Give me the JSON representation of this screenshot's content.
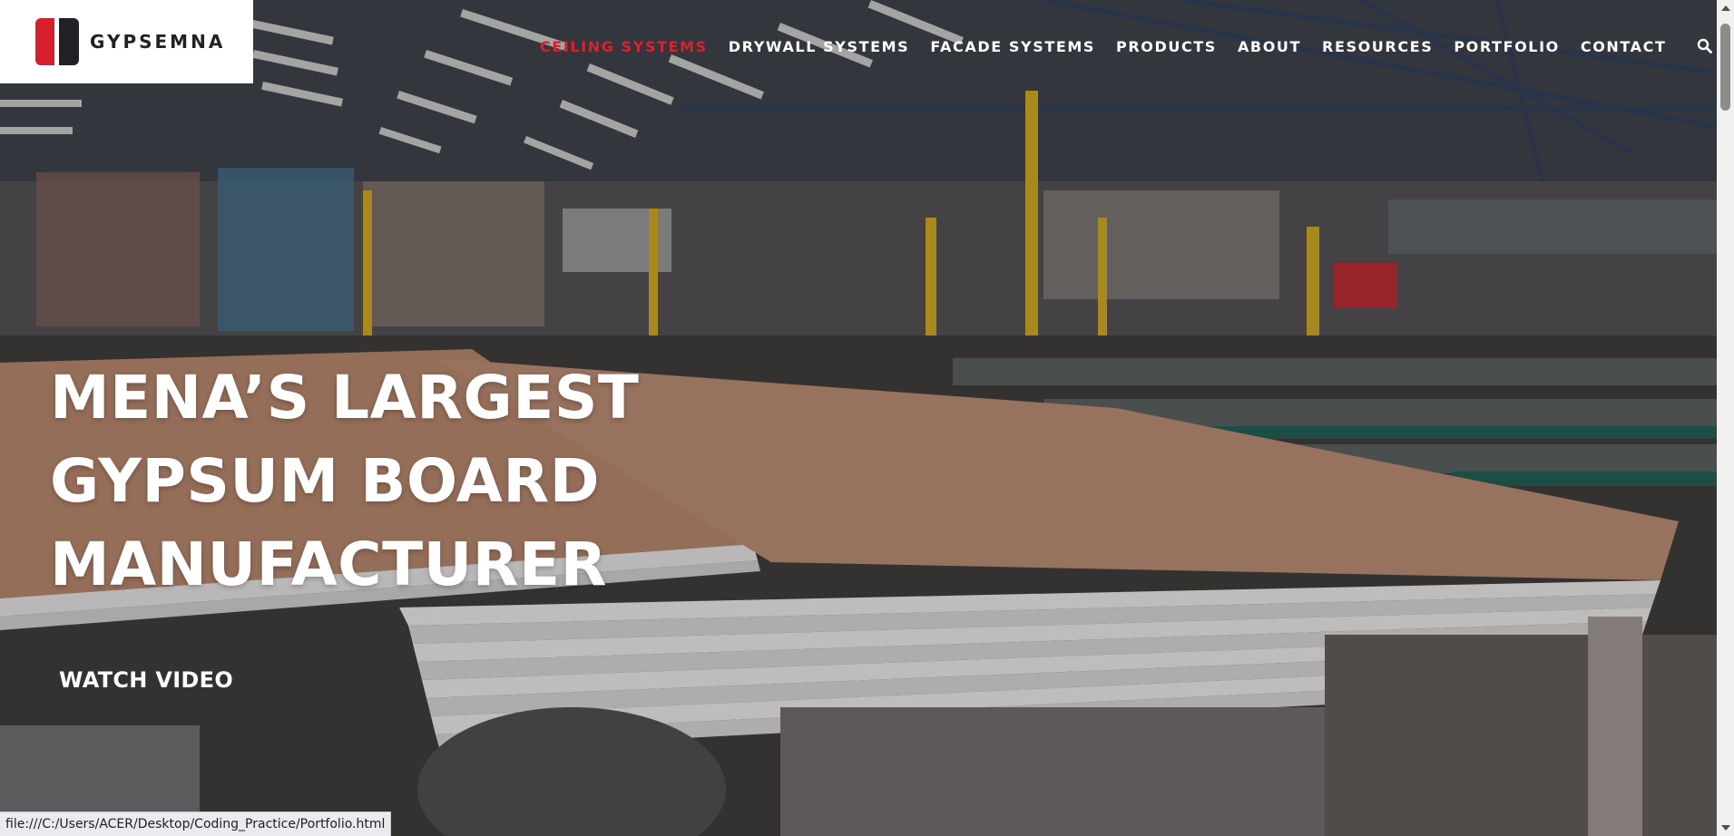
{
  "brand": {
    "name": "GYPSEMNA",
    "accent_color": "#d71e2b",
    "dark_color": "#222226"
  },
  "nav": {
    "items": [
      {
        "label": "CEILING SYSTEMS",
        "active": true
      },
      {
        "label": "DRYWALL SYSTEMS",
        "active": false
      },
      {
        "label": "FACADE SYSTEMS",
        "active": false
      },
      {
        "label": "PRODUCTS",
        "active": false
      },
      {
        "label": "ABOUT",
        "active": false
      },
      {
        "label": "RESOURCES",
        "active": false
      },
      {
        "label": "PORTFOLIO",
        "active": false
      },
      {
        "label": "CONTACT",
        "active": false
      }
    ],
    "search_icon": "search-icon",
    "menu_icon": "hamburger-menu-icon"
  },
  "hero": {
    "headline_lines": [
      "MENA’S LARGEST",
      "GYPSUM BOARD",
      "MANUFACTURER"
    ],
    "cta_label": "WATCH VIDEO",
    "background": "factory-gypsum-board-production-line-photo"
  },
  "status_bar": {
    "url": "file:///C:/Users/ACER/Desktop/Coding_Practice/Portfolio.html"
  }
}
